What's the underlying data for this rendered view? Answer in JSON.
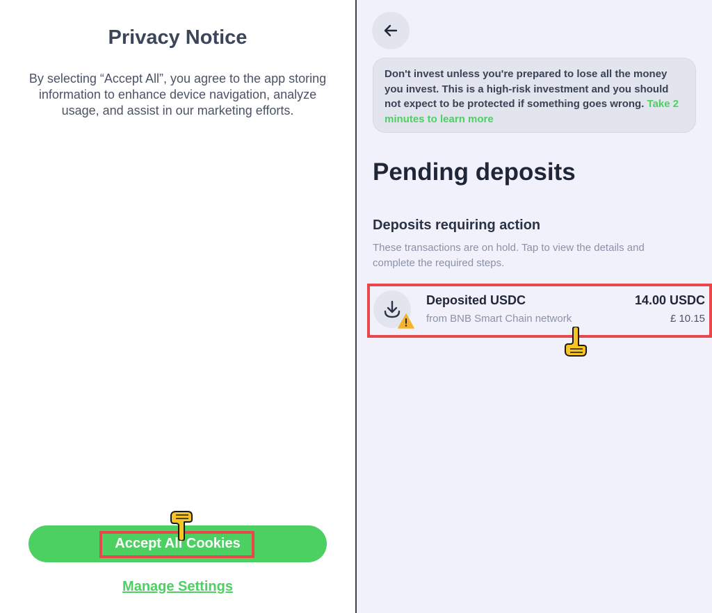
{
  "privacy": {
    "title": "Privacy Notice",
    "body": "By selecting “Accept All”, you agree to the app storing information to enhance device navigation, analyze usage, and assist in our marketing efforts.",
    "accept_label": "Accept All Cookies",
    "manage_label": "Manage Settings"
  },
  "deposits": {
    "warning_text": "Don't invest unless you're prepared to lose all the money you invest. This is a high-risk investment and you should not expect to be protected if something goes wrong.",
    "warning_link": "Take 2 minutes to learn more",
    "page_title": "Pending deposits",
    "section_title": "Deposits requiring action",
    "section_desc": "These transactions are on hold. Tap to view the details and complete the required steps.",
    "items": [
      {
        "title": "Deposited USDC",
        "subtitle": "from BNB Smart Chain network",
        "amount": "14.00 USDC",
        "fiat": "£ 10.15"
      }
    ]
  },
  "icons": {
    "back": "arrow-left-icon",
    "deposit": "download-arrow-icon",
    "warning": "warning-triangle-icon",
    "pointer": "pointing-hand-icon"
  },
  "colors": {
    "accent_green": "#4cd061",
    "highlight_red": "#e8474c",
    "right_bg": "#f0f1fa",
    "warning_yellow": "#f4b32a"
  }
}
